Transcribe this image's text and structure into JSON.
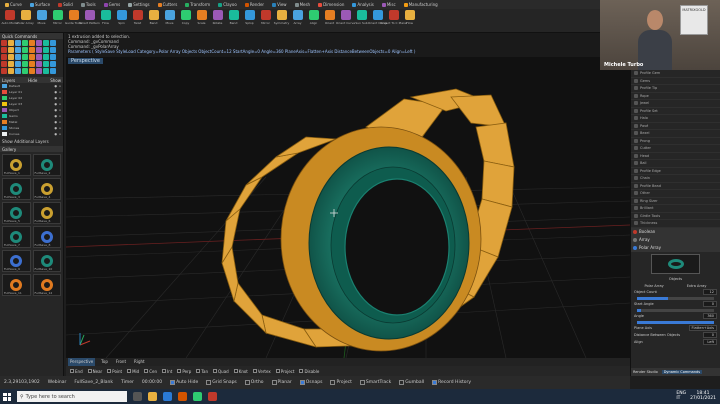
{
  "tabs": [
    {
      "label": "Curve",
      "color": "#e8b040"
    },
    {
      "label": "Surface",
      "color": "#4aa3df"
    },
    {
      "label": "Solid",
      "color": "#c0392b"
    },
    {
      "label": "Tools",
      "color": "#7f8c8d"
    },
    {
      "label": "Gems",
      "color": "#8e44ad"
    },
    {
      "label": "Settings",
      "color": "#95a5a6"
    },
    {
      "label": "Cutters",
      "color": "#e67e22"
    },
    {
      "label": "Transform",
      "color": "#27ae60"
    },
    {
      "label": "Clayoo",
      "color": "#16a085"
    },
    {
      "label": "Render",
      "color": "#d35400"
    },
    {
      "label": "View",
      "color": "#2980b9"
    },
    {
      "label": "Mesh",
      "color": "#7f8c8d"
    },
    {
      "label": "Dimension",
      "color": "#e74c3c"
    },
    {
      "label": "Analysis",
      "color": "#3498db"
    },
    {
      "label": "Misc",
      "color": "#9b59b6"
    },
    {
      "label": "Manufacturing",
      "color": "#f39c12"
    }
  ],
  "ribbon_tools": [
    "Auto Mode",
    "Polar Array",
    "Move",
    "Mirror",
    "Guide Tools",
    "Smart Pattern",
    "Flow",
    "Spin",
    "Twist",
    "Bend",
    "Move",
    "Copy",
    "Scale",
    "Rotate",
    "Bend",
    "Splop",
    "Mirror",
    "Symmetry",
    "Array",
    "Align",
    "Orient",
    "Orient Curve",
    "Sun Sub",
    "Orient Curve",
    "Project To C Plane",
    "Flow"
  ],
  "command": {
    "line1": "1 extrusion added to selection.",
    "line2": "Command: _gvCommand",
    "line3": "Command: _gvPolarArray",
    "params": "Parameters ( StyleSave  StyleLoad  Category=Polar Array  Objects  ObjectCount=12  StartAngle=0  Angle=360  PlaneAxis=Flatten+Axis  DistanceBetweenObjects=0  Align=Left )"
  },
  "left_panel": {
    "quick_commands": "Quick Commands",
    "layers_title": "Layers",
    "layers_hide": "Hide",
    "layers_show": "Show",
    "layer_rows": [
      {
        "name": "Default",
        "color": "#4aa3df"
      },
      {
        "name": "Layer 01",
        "color": "#e74c3c"
      },
      {
        "name": "Layer 02",
        "color": "#2ecc71"
      },
      {
        "name": "Layer 03",
        "color": "#f1c40f"
      },
      {
        "name": "Object",
        "color": "#9b59b6"
      },
      {
        "name": "Gems",
        "color": "#1abc9c"
      },
      {
        "name": "Metal",
        "color": "#e67e22"
      },
      {
        "name": "Stones",
        "color": "#3498db"
      },
      {
        "name": "Curves",
        "color": "#ecf0f1"
      }
    ],
    "show_additional_layers": "Show Additional Layers",
    "gallery_title": "Gallery",
    "thumbs": [
      {
        "caption": "FullSave_1",
        "kind": "gold"
      },
      {
        "caption": "FullSave_2",
        "kind": "teal"
      },
      {
        "caption": "FullSave_3",
        "kind": "teal"
      },
      {
        "caption": "FullSave_4",
        "kind": "gold"
      },
      {
        "caption": "FullSave_5",
        "kind": "teal"
      },
      {
        "caption": "FullSave_6",
        "kind": "gold"
      },
      {
        "caption": "FullSave_7",
        "kind": "teal"
      },
      {
        "caption": "FullSave_8",
        "kind": "blue"
      },
      {
        "caption": "FullSave_9",
        "kind": "blue"
      },
      {
        "caption": "FullSave_10",
        "kind": "teal"
      },
      {
        "caption": "FullSave_11",
        "kind": "orange"
      },
      {
        "caption": "FullSave_12",
        "kind": "orange"
      }
    ]
  },
  "viewport": {
    "title": "Perspective",
    "tabs": [
      "Perspective",
      "Top",
      "Front",
      "Right"
    ],
    "active_tab": "Perspective"
  },
  "snaps": [
    "End",
    "Near",
    "Point",
    "Mid",
    "Cen",
    "Int",
    "Perp",
    "Tan",
    "Quad",
    "Knot",
    "Vertex",
    "Project",
    "Disable"
  ],
  "status": {
    "coords": "2.3,29103,1902",
    "webinar": "Webinar",
    "file": "FullSave_2_Blank",
    "timer_label": "Timer",
    "timer_value": "00:00:00",
    "toggles": [
      {
        "label": "Auto Hide",
        "on": true
      },
      {
        "label": "Grid Snaps",
        "on": false
      },
      {
        "label": "Ortho",
        "on": false
      },
      {
        "label": "Planar",
        "on": false
      },
      {
        "label": "Osnaps",
        "on": true
      },
      {
        "label": "Project",
        "on": false
      },
      {
        "label": "SmartTrack",
        "on": false
      },
      {
        "label": "Gumball",
        "on": false
      },
      {
        "label": "Record History",
        "on": true
      }
    ]
  },
  "webcam": {
    "name": "Michele Turbo",
    "logo_text": "MATRIXGOLD"
  },
  "right_panel": {
    "rows": [
      "Profile Gem",
      "Gems",
      "Profile Tip",
      "Rope",
      "Jewel",
      "Profile Set",
      "Halo",
      "Pavé",
      "Bezel",
      "Prong",
      "Cutter",
      "Head",
      "Bail",
      "Profile Edge",
      "Chain",
      "Profile Bead",
      "Other",
      "Ring Sizer",
      "Brilliant",
      "Girdle Tools",
      "Thickness"
    ],
    "section_boolean": "Boolean",
    "section_array": "Array",
    "section_polar": "Polar Array",
    "polar_caption": "Objects",
    "ptabs": [
      "Polar Array",
      "Extra Array"
    ],
    "props": [
      {
        "label": "Object Count",
        "value": "12"
      },
      {
        "label": "Start Angle",
        "value": "0"
      },
      {
        "label": "Angle",
        "value": "360"
      },
      {
        "label": "Plane Axis",
        "value": "Flatten+Axis"
      },
      {
        "label": "Distance Between Objects",
        "value": "0"
      },
      {
        "label": "Align",
        "value": "Left"
      }
    ],
    "bottom_tabs": [
      "Render Studio",
      "Dynamic Commands"
    ]
  },
  "taskbar": {
    "search_placeholder": "Type here to search",
    "lang": "ENG",
    "region": "IT",
    "time": "18:41",
    "date": "27/01/2021"
  }
}
